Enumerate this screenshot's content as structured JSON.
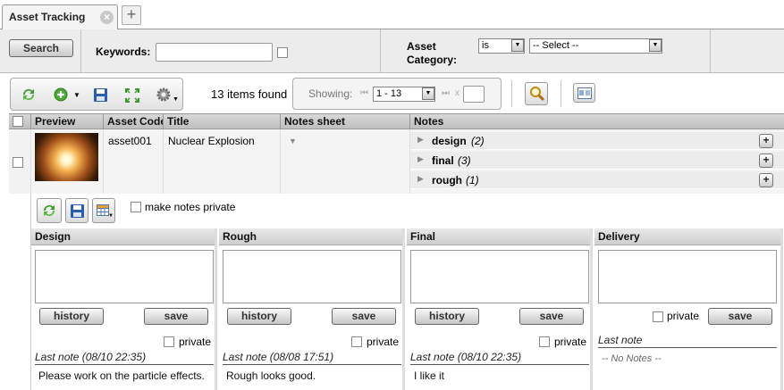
{
  "tabs": [
    {
      "label": "Asset Tracking"
    }
  ],
  "search": {
    "button": "Search",
    "keywords_label": "Keywords:",
    "keywords_value": "",
    "category_label_1": "Asset",
    "category_label_2": "Category:",
    "operator": "is",
    "category_value": "-- Select --"
  },
  "toolbar": {
    "items_found": "13 items found",
    "showing_label": "Showing:",
    "page_range": "1 - 13",
    "page_close": "x"
  },
  "grid": {
    "columns": [
      "Preview",
      "Asset Code",
      "Title",
      "Notes sheet",
      "Notes"
    ],
    "rows": [
      {
        "asset_code": "asset001",
        "title": "Nuclear Explosion",
        "notes": [
          {
            "name": "design",
            "count": "(2)"
          },
          {
            "name": "final",
            "count": "(3)"
          },
          {
            "name": "rough",
            "count": "(1)"
          }
        ]
      }
    ]
  },
  "detail": {
    "make_private_label": "make notes private",
    "columns": [
      {
        "title": "Design",
        "history": "history",
        "save": "save",
        "private": "private",
        "last_note": "Last note",
        "last_note_date": "(08/10 22:35)",
        "note": "Please work on the particle effects."
      },
      {
        "title": "Rough",
        "history": "history",
        "save": "save",
        "private": "private",
        "last_note": "Last note",
        "last_note_date": "(08/08 17:51)",
        "note": "Rough looks good."
      },
      {
        "title": "Final",
        "history": "history",
        "save": "save",
        "private": "private",
        "last_note": "Last note",
        "last_note_date": "(08/10 22:35)",
        "note": "I like it"
      },
      {
        "title": "Delivery",
        "save": "save",
        "private": "private",
        "last_note": "Last note",
        "note": "-- No Notes --"
      }
    ]
  },
  "colors": {
    "accent_green": "#3a9a2a",
    "save_blue": "#2a5cb0",
    "header_gray": "#c8c8c8"
  }
}
